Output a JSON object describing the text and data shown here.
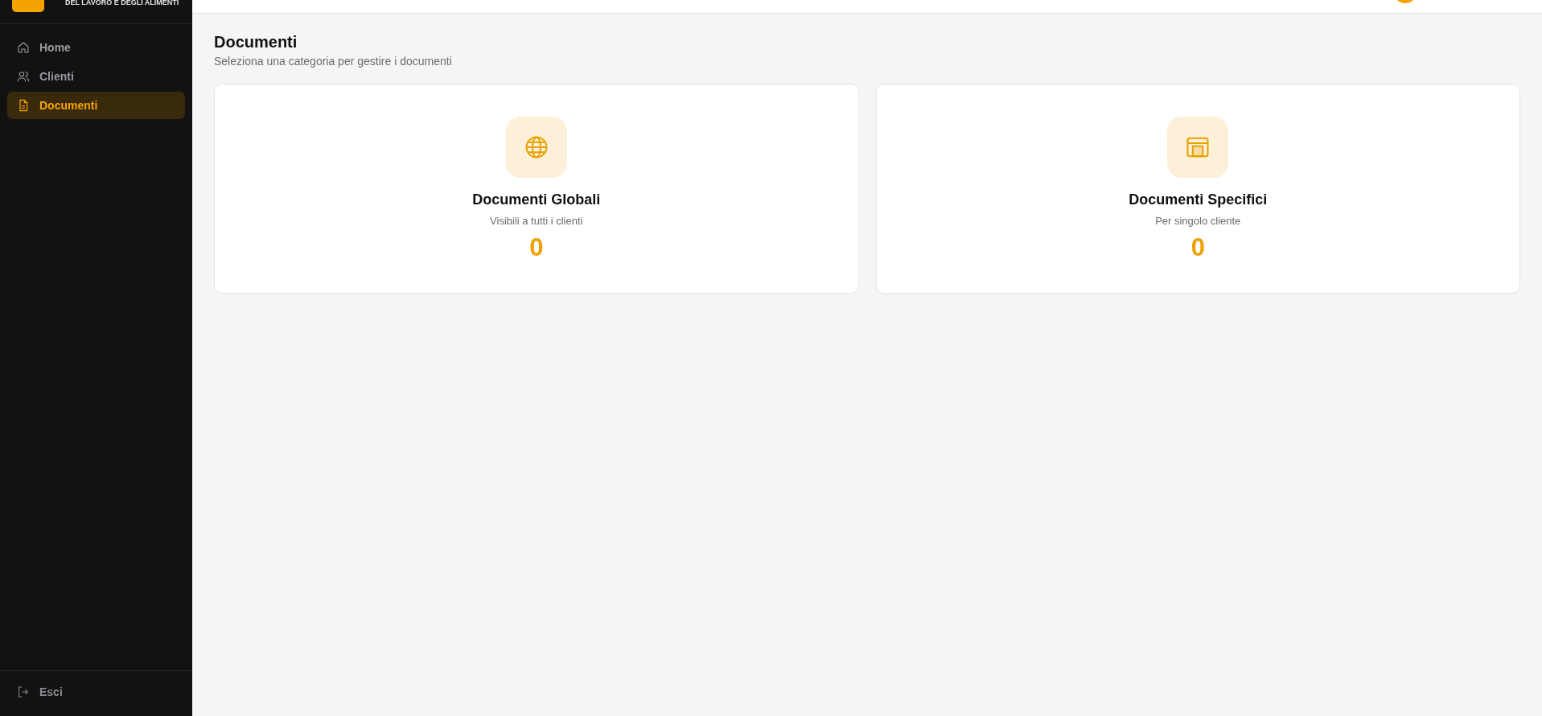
{
  "sidebar": {
    "brand_subtitle": "DEL LAVORO E DEGLI ALIMENTI",
    "items": [
      {
        "label": "Home",
        "kind": "home",
        "selected": false
      },
      {
        "label": "Clienti",
        "kind": "users",
        "selected": false
      },
      {
        "label": "Documenti",
        "kind": "document",
        "selected": true
      }
    ],
    "logout": "Esci"
  },
  "page": {
    "title": "Documenti",
    "subtitle": "Seleziona una categoria per gestire i documenti"
  },
  "cards": [
    {
      "kind": "globe",
      "title": "Documenti Globali",
      "subtitle": "Visibili a tutti i clienti",
      "count": "0"
    },
    {
      "kind": "window",
      "title": "Documenti Specifici",
      "subtitle": "Per singolo cliente",
      "count": "0"
    }
  ]
}
